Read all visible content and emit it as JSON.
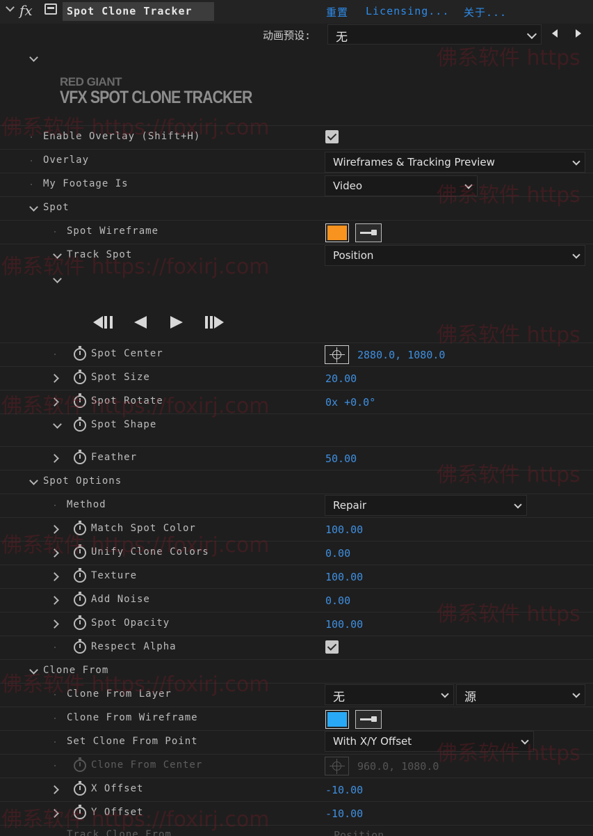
{
  "header": {
    "title": "Spot Clone Tracker",
    "links": [
      "重置",
      "Licensing...",
      "关于..."
    ]
  },
  "preset": {
    "label": "动画预设:",
    "value": "无"
  },
  "logo": {
    "brand": "RED GIANT",
    "product": "VFX SPOT CLONE TRACKER"
  },
  "watermark": {
    "text": "佛系软件 https://foxirj.com",
    "text_short": "佛系软件 https"
  },
  "rows": {
    "enable_overlay": {
      "label": "Enable Overlay (Shift+H)"
    },
    "overlay": {
      "label": "Overlay",
      "value": "Wireframes & Tracking Preview"
    },
    "my_footage": {
      "label": "My Footage Is",
      "value": "Video"
    },
    "spot": {
      "label": "Spot"
    },
    "spot_wireframe": {
      "label": "Spot Wireframe",
      "color": "#f7931e"
    },
    "track_spot": {
      "label": "Track Spot",
      "value": "Position"
    },
    "spot_center": {
      "label": "Spot Center",
      "value": "2880.0, 1080.0"
    },
    "spot_size": {
      "label": "Spot Size",
      "value": "20.00"
    },
    "spot_rotate": {
      "label": "Spot Rotate",
      "value": "0x +0.0°"
    },
    "spot_shape": {
      "label": "Spot Shape"
    },
    "feather": {
      "label": "Feather",
      "value": "50.00"
    },
    "spot_options": {
      "label": "Spot Options"
    },
    "method": {
      "label": "Method",
      "value": "Repair"
    },
    "match_spot_color": {
      "label": "Match Spot Color",
      "value": "100.00"
    },
    "unify_clone_colors": {
      "label": "Unify Clone Colors",
      "value": "0.00"
    },
    "texture": {
      "label": "Texture",
      "value": "100.00"
    },
    "add_noise": {
      "label": "Add Noise",
      "value": "0.00"
    },
    "spot_opacity": {
      "label": "Spot Opacity",
      "value": "100.00"
    },
    "respect_alpha": {
      "label": "Respect Alpha"
    },
    "clone_from": {
      "label": "Clone From"
    },
    "clone_from_layer": {
      "label": "Clone From Layer",
      "value": "无",
      "value2": "源"
    },
    "clone_from_wireframe": {
      "label": "Clone From Wireframe",
      "color": "#29a9f5"
    },
    "set_clone_from_point": {
      "label": "Set Clone From Point",
      "value": "With X/Y Offset"
    },
    "clone_from_center": {
      "label": "Clone From Center",
      "value": "960.0, 1080.0"
    },
    "x_offset": {
      "label": "X Offset",
      "value": "-10.00"
    },
    "y_offset": {
      "label": "Y Offset",
      "value": "-10.00"
    },
    "track_clone_from": {
      "label": "Track Clone From",
      "value": "Position"
    }
  }
}
